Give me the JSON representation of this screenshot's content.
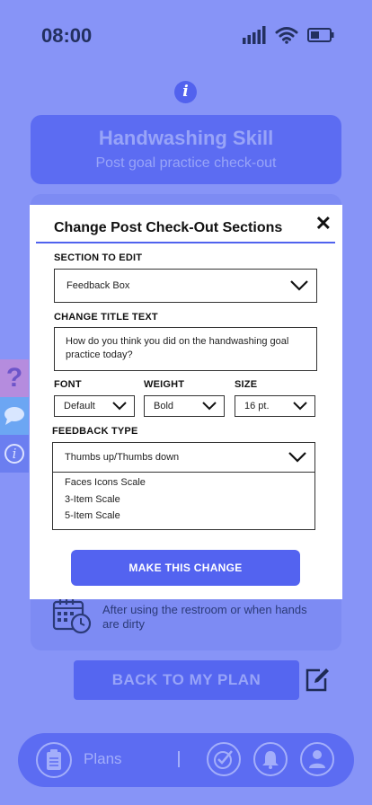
{
  "status": {
    "time": "08:00"
  },
  "header": {
    "title": "Handwashing Skill",
    "subtitle": "Post goal practice check-out"
  },
  "goal": {
    "text": "After using the restroom or when hands are dirty"
  },
  "back_button": {
    "label": "BACK TO MY PLAN"
  },
  "nav": {
    "plans_label": "Plans"
  },
  "modal": {
    "title": "Change Post Check-Out Sections",
    "section_label": "SECTION TO EDIT",
    "section_value": "Feedback Box",
    "title_text_label": "CHANGE TITLE TEXT",
    "title_text_value": "How do you think you did on the handwashing goal practice today?",
    "font_label": "FONT",
    "font_value": "Default",
    "weight_label": "WEIGHT",
    "weight_value": "Bold",
    "size_label": "SIZE",
    "size_value": "16 pt.",
    "feedback_label": "FEEDBACK TYPE",
    "feedback_value": "Thumbs up/Thumbs down",
    "feedback_options": [
      "Faces Icons Scale",
      "3-Item Scale",
      "5-Item Scale"
    ],
    "submit_label": "MAKE THIS CHANGE"
  },
  "colors": {
    "background": "#8794f7",
    "accent": "#5363f0",
    "dark_text": "#23305f"
  }
}
